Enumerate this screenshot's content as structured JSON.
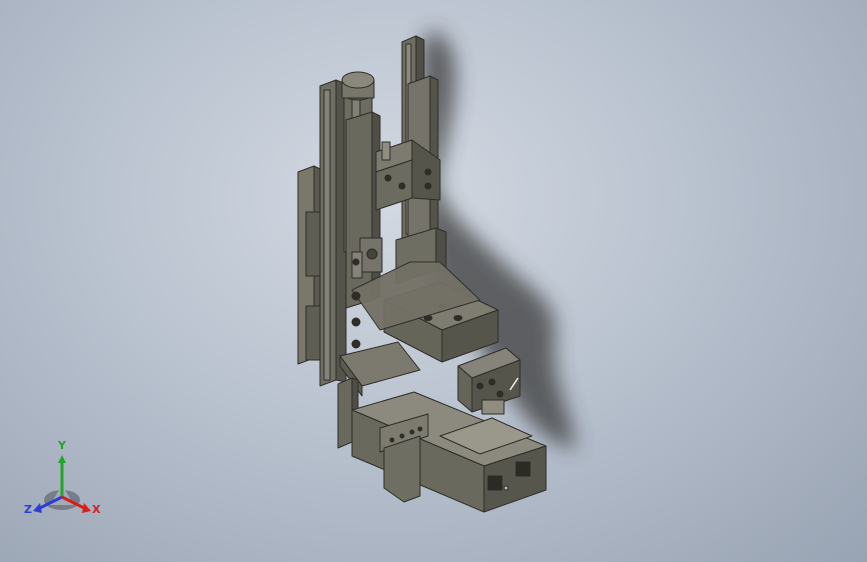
{
  "viewport": {
    "background_top": "#d3d9e2",
    "background_bottom": "#98a3b3",
    "model_color": "#6f6e63",
    "model_dark": "#4a4942",
    "model_light": "#8e8c7f",
    "shadow_color": "#3a3a3a"
  },
  "triad": {
    "x_label": "X",
    "y_label": "Y",
    "z_label": "Z",
    "x_color": "#d61f1f",
    "y_color": "#22a52a",
    "z_color": "#2a3fd6"
  }
}
